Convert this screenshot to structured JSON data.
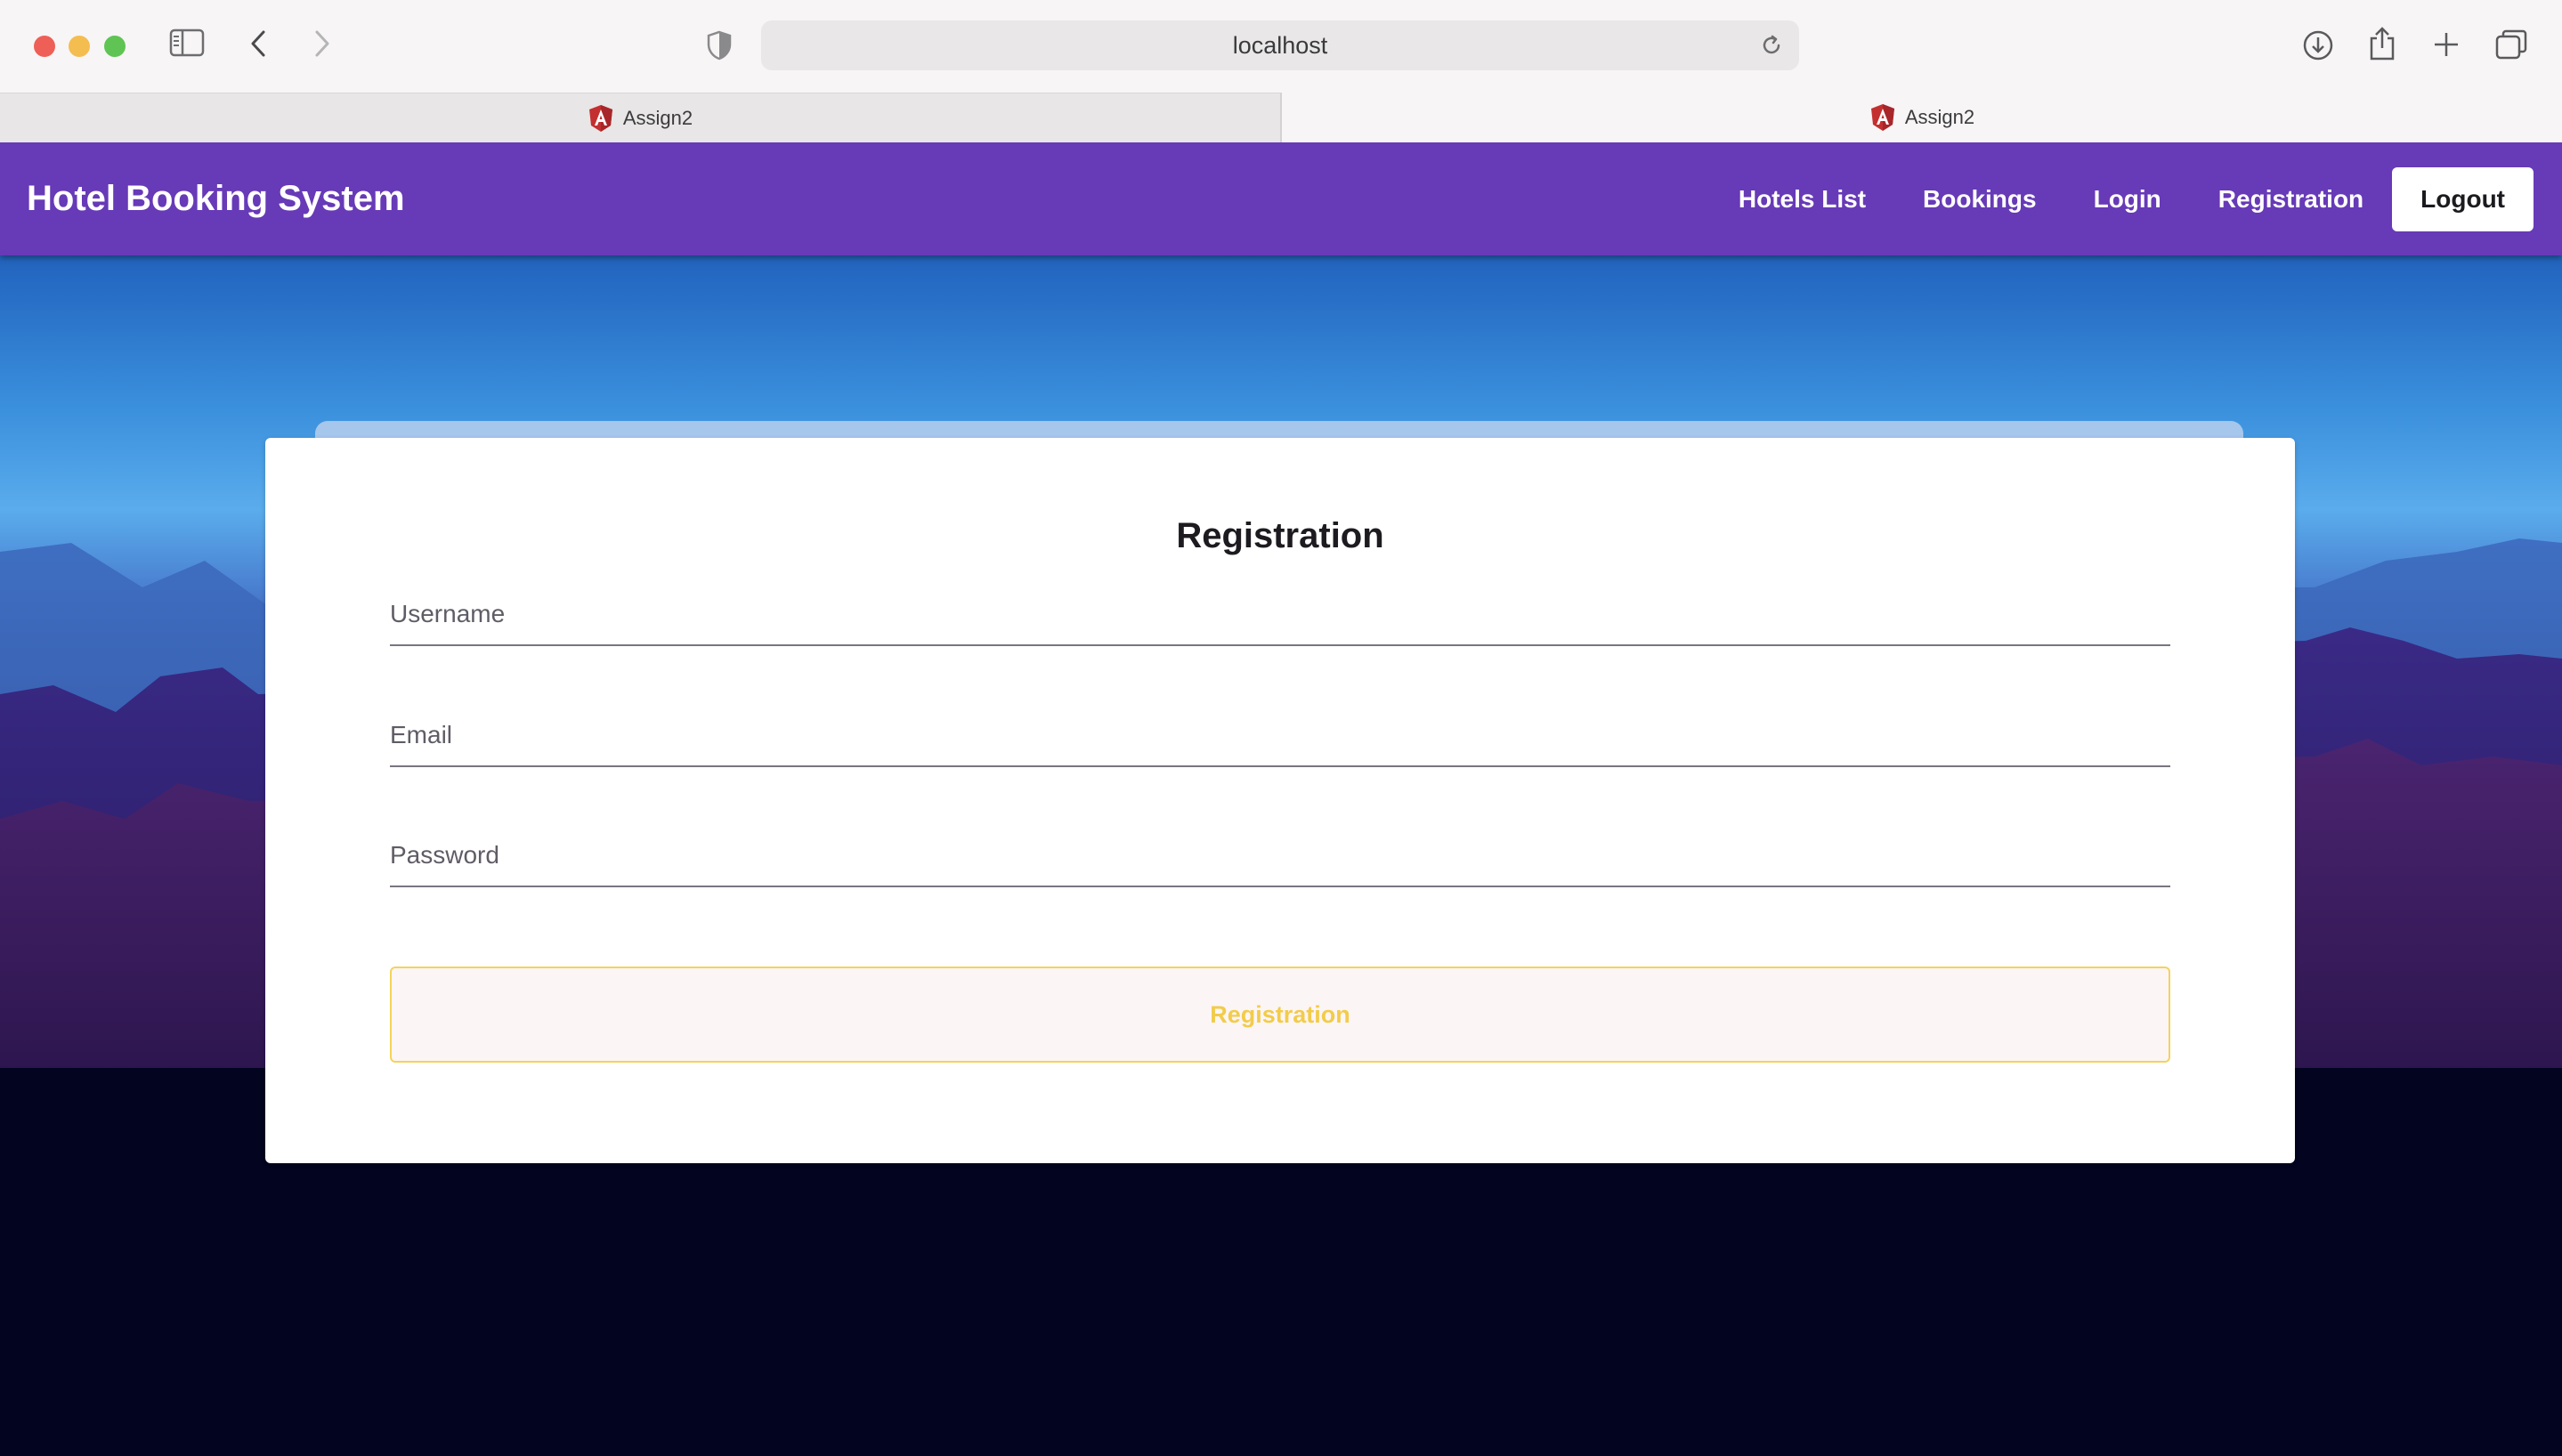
{
  "browser": {
    "url": "localhost",
    "tabs": [
      {
        "label": "Assign2",
        "active": false
      },
      {
        "label": "Assign2",
        "active": true
      }
    ]
  },
  "header": {
    "brand": "Hotel Booking System",
    "nav": {
      "hotels": "Hotels List",
      "bookings": "Bookings",
      "login": "Login",
      "registration": "Registration",
      "logout": "Logout"
    },
    "color": "#673ab7"
  },
  "form": {
    "title": "Registration",
    "username_placeholder": "Username",
    "email_placeholder": "Email",
    "password_placeholder": "Password",
    "submit_label": "Registration",
    "submit_color": "#f2cc4a"
  }
}
